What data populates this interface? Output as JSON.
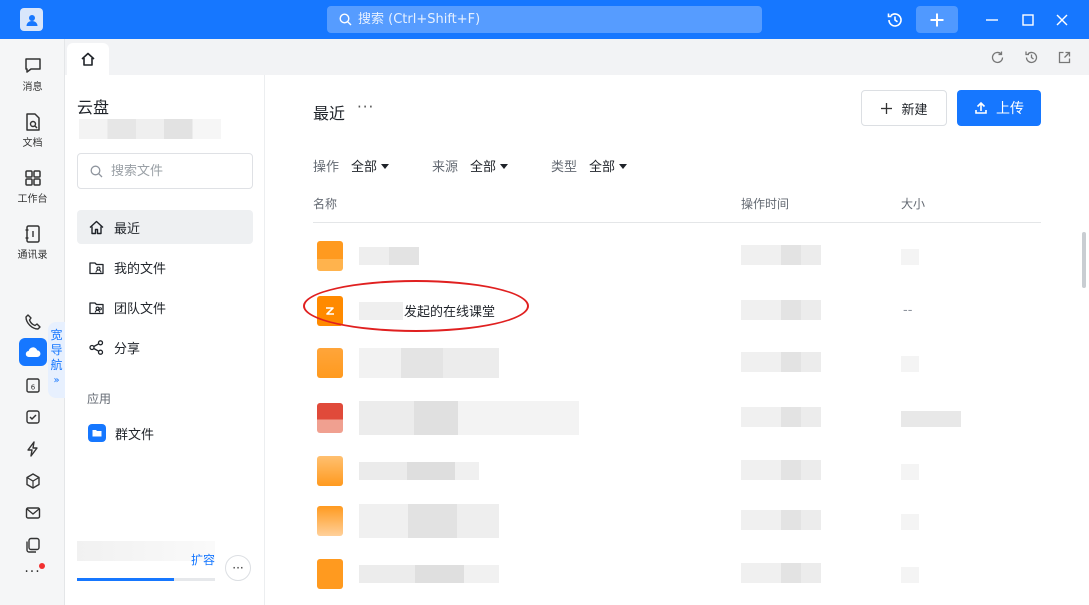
{
  "titlebar": {
    "search_placeholder": "搜索 (Ctrl+Shift+F)",
    "accent": "#1677ff"
  },
  "rail": {
    "items": [
      {
        "label": "消息",
        "icon": "message-icon"
      },
      {
        "label": "文档",
        "icon": "document-icon"
      },
      {
        "label": "工作台",
        "icon": "workbench-icon"
      },
      {
        "label": "通讯录",
        "icon": "contacts-icon"
      }
    ],
    "wide_nav": [
      "宽",
      "导",
      "航"
    ],
    "wide_nav_arrow": "»",
    "more": "···"
  },
  "sidebar": {
    "title": "云盘",
    "search_placeholder": "搜索文件",
    "items": [
      {
        "label": "最近",
        "icon": "home-icon",
        "active": true
      },
      {
        "label": "我的文件",
        "icon": "my-folder-icon",
        "active": false
      },
      {
        "label": "团队文件",
        "icon": "team-folder-icon",
        "active": false
      },
      {
        "label": "分享",
        "icon": "share-icon",
        "active": false
      }
    ],
    "section_apps": "应用",
    "group_files": "群文件",
    "expand": "扩容",
    "more": "···",
    "storage_used_fraction": 0.7
  },
  "main": {
    "title": "最近",
    "title_more": "···",
    "new_label": "新建",
    "upload_label": "上传",
    "filters": [
      {
        "label": "操作",
        "value": "全部"
      },
      {
        "label": "来源",
        "value": "全部"
      },
      {
        "label": "类型",
        "value": "全部"
      }
    ],
    "columns": {
      "name": "名称",
      "time": "操作时间",
      "size": "大小"
    },
    "highlighted_row": {
      "name": "发起的在线课堂",
      "size": "--"
    }
  }
}
